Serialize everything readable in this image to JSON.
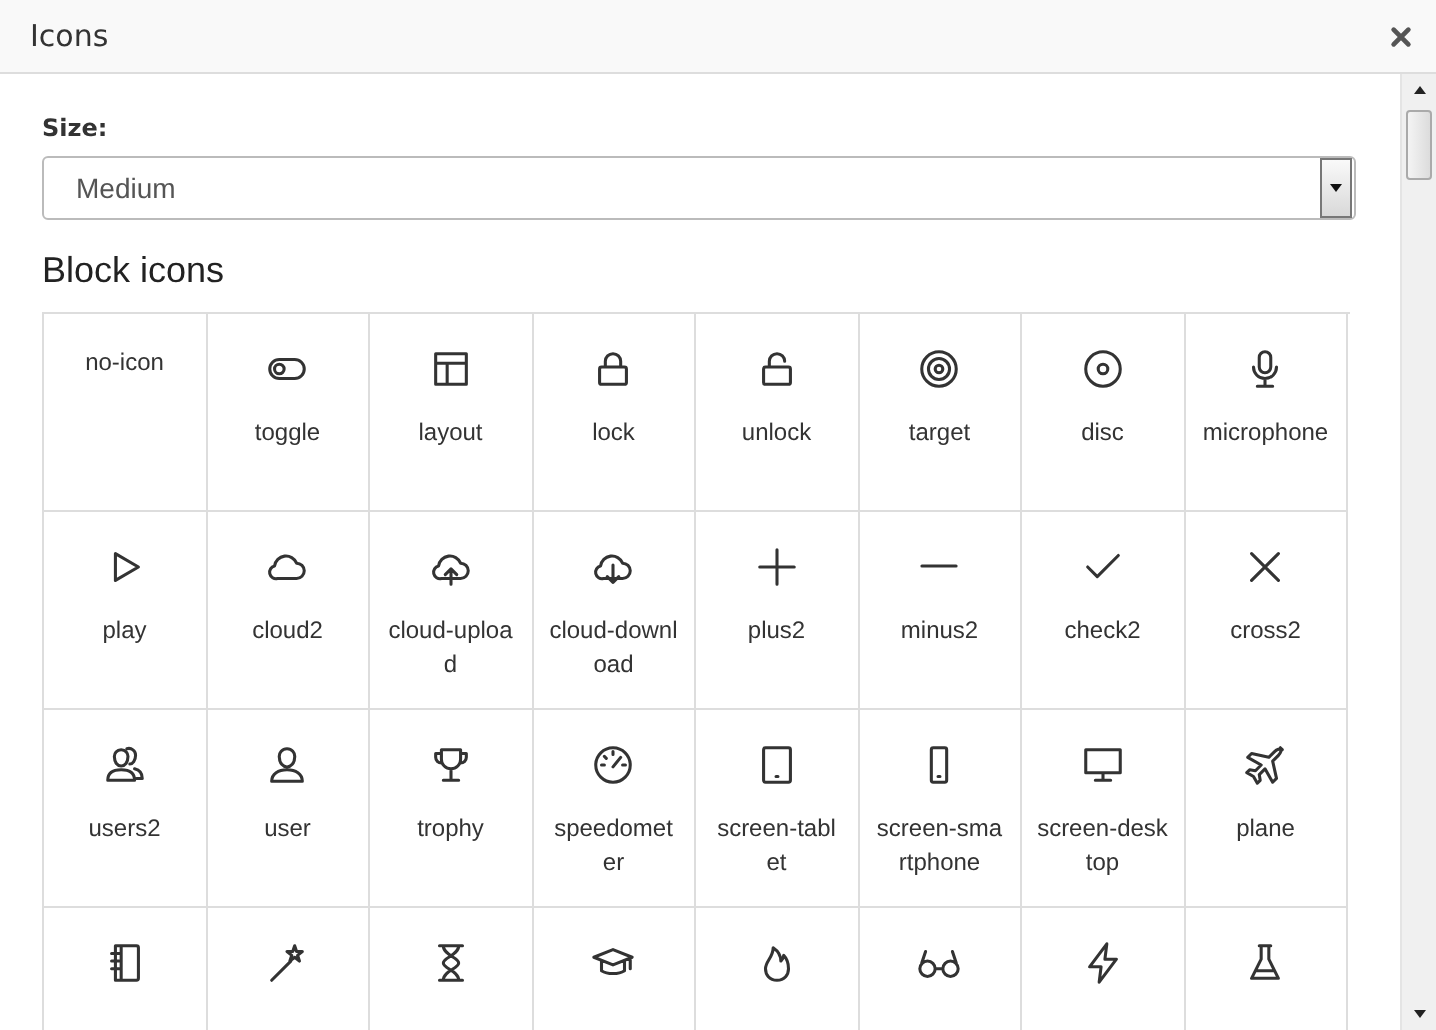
{
  "window": {
    "title": "Icons"
  },
  "size_field": {
    "label": "Size:",
    "value": "Medium"
  },
  "section_title": "Block icons",
  "icons": [
    {
      "kind": "none",
      "label": "no-icon"
    },
    {
      "kind": "toggle",
      "label": "toggle"
    },
    {
      "kind": "layout",
      "label": "layout"
    },
    {
      "kind": "lock",
      "label": "lock"
    },
    {
      "kind": "unlock",
      "label": "unlock"
    },
    {
      "kind": "target",
      "label": "target"
    },
    {
      "kind": "disc",
      "label": "disc"
    },
    {
      "kind": "microphone",
      "label": "microphone"
    },
    {
      "kind": "play",
      "label": "play"
    },
    {
      "kind": "cloud",
      "label": "cloud2"
    },
    {
      "kind": "cloud_upload",
      "label": "cloud-upload"
    },
    {
      "kind": "cloud_download",
      "label": "cloud-download"
    },
    {
      "kind": "plus",
      "label": "plus2"
    },
    {
      "kind": "minus",
      "label": "minus2"
    },
    {
      "kind": "check",
      "label": "check2"
    },
    {
      "kind": "cross",
      "label": "cross2"
    },
    {
      "kind": "users",
      "label": "users2"
    },
    {
      "kind": "user",
      "label": "user"
    },
    {
      "kind": "trophy",
      "label": "trophy"
    },
    {
      "kind": "speedometer",
      "label": "speedometer"
    },
    {
      "kind": "tablet",
      "label": "screen-tablet"
    },
    {
      "kind": "smartphone",
      "label": "screen-smartphone"
    },
    {
      "kind": "desktop",
      "label": "screen-desktop"
    },
    {
      "kind": "plane",
      "label": "plane"
    },
    {
      "kind": "notebook"
    },
    {
      "kind": "wand"
    },
    {
      "kind": "hourglass"
    },
    {
      "kind": "graduation"
    },
    {
      "kind": "fire"
    },
    {
      "kind": "glasses"
    },
    {
      "kind": "bolt"
    },
    {
      "kind": "flask"
    }
  ]
}
